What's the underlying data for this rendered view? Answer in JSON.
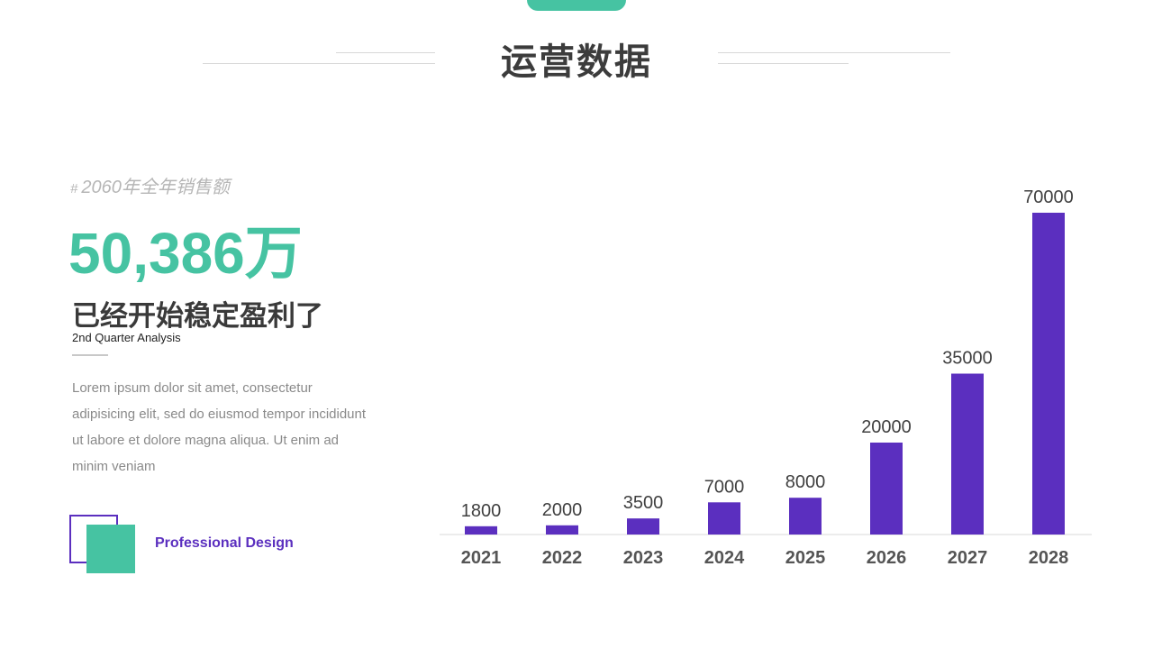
{
  "header": {
    "title": "运营数据"
  },
  "left": {
    "tag_hash": "#",
    "tag_text": "2060年全年销售额",
    "big_number": "50,386万",
    "heading": "已经开始稳定盈利了",
    "analysis": "2nd Quarter Analysis",
    "paragraph": "Lorem ipsum dolor sit amet, consectetur adipisicing elit, sed do eiusmod tempor incididunt ut labore et dolore magna aliqua. Ut enim ad minim veniam",
    "pro_label": "Professional Design"
  },
  "colors": {
    "accent": "#46c3a2",
    "bar": "#5b2fbf",
    "text_dark": "#3c3c3c"
  },
  "chart_data": {
    "type": "bar",
    "categories": [
      "2021",
      "2022",
      "2023",
      "2024",
      "2025",
      "2026",
      "2027",
      "2028"
    ],
    "values": [
      1800,
      2000,
      3500,
      7000,
      8000,
      20000,
      35000,
      70000
    ],
    "ylim": [
      0,
      80000
    ],
    "grid": false,
    "legend": "none"
  }
}
